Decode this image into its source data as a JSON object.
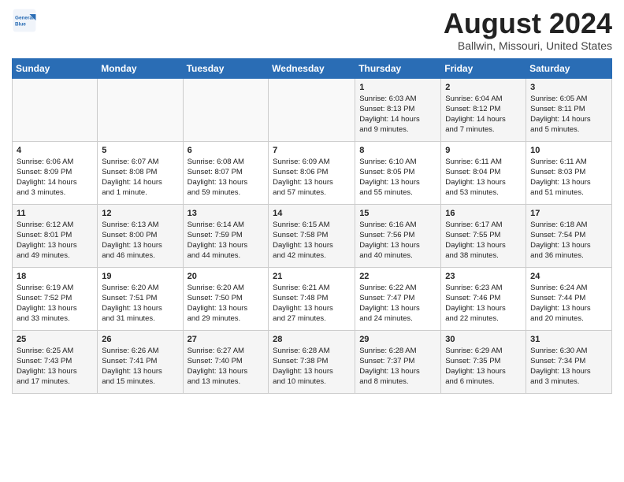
{
  "header": {
    "logo_line1": "General",
    "logo_line2": "Blue",
    "month_title": "August 2024",
    "location": "Ballwin, Missouri, United States"
  },
  "weekdays": [
    "Sunday",
    "Monday",
    "Tuesday",
    "Wednesday",
    "Thursday",
    "Friday",
    "Saturday"
  ],
  "weeks": [
    [
      {
        "day": "",
        "info": ""
      },
      {
        "day": "",
        "info": ""
      },
      {
        "day": "",
        "info": ""
      },
      {
        "day": "",
        "info": ""
      },
      {
        "day": "1",
        "info": "Sunrise: 6:03 AM\nSunset: 8:13 PM\nDaylight: 14 hours\nand 9 minutes."
      },
      {
        "day": "2",
        "info": "Sunrise: 6:04 AM\nSunset: 8:12 PM\nDaylight: 14 hours\nand 7 minutes."
      },
      {
        "day": "3",
        "info": "Sunrise: 6:05 AM\nSunset: 8:11 PM\nDaylight: 14 hours\nand 5 minutes."
      }
    ],
    [
      {
        "day": "4",
        "info": "Sunrise: 6:06 AM\nSunset: 8:09 PM\nDaylight: 14 hours\nand 3 minutes."
      },
      {
        "day": "5",
        "info": "Sunrise: 6:07 AM\nSunset: 8:08 PM\nDaylight: 14 hours\nand 1 minute."
      },
      {
        "day": "6",
        "info": "Sunrise: 6:08 AM\nSunset: 8:07 PM\nDaylight: 13 hours\nand 59 minutes."
      },
      {
        "day": "7",
        "info": "Sunrise: 6:09 AM\nSunset: 8:06 PM\nDaylight: 13 hours\nand 57 minutes."
      },
      {
        "day": "8",
        "info": "Sunrise: 6:10 AM\nSunset: 8:05 PM\nDaylight: 13 hours\nand 55 minutes."
      },
      {
        "day": "9",
        "info": "Sunrise: 6:11 AM\nSunset: 8:04 PM\nDaylight: 13 hours\nand 53 minutes."
      },
      {
        "day": "10",
        "info": "Sunrise: 6:11 AM\nSunset: 8:03 PM\nDaylight: 13 hours\nand 51 minutes."
      }
    ],
    [
      {
        "day": "11",
        "info": "Sunrise: 6:12 AM\nSunset: 8:01 PM\nDaylight: 13 hours\nand 49 minutes."
      },
      {
        "day": "12",
        "info": "Sunrise: 6:13 AM\nSunset: 8:00 PM\nDaylight: 13 hours\nand 46 minutes."
      },
      {
        "day": "13",
        "info": "Sunrise: 6:14 AM\nSunset: 7:59 PM\nDaylight: 13 hours\nand 44 minutes."
      },
      {
        "day": "14",
        "info": "Sunrise: 6:15 AM\nSunset: 7:58 PM\nDaylight: 13 hours\nand 42 minutes."
      },
      {
        "day": "15",
        "info": "Sunrise: 6:16 AM\nSunset: 7:56 PM\nDaylight: 13 hours\nand 40 minutes."
      },
      {
        "day": "16",
        "info": "Sunrise: 6:17 AM\nSunset: 7:55 PM\nDaylight: 13 hours\nand 38 minutes."
      },
      {
        "day": "17",
        "info": "Sunrise: 6:18 AM\nSunset: 7:54 PM\nDaylight: 13 hours\nand 36 minutes."
      }
    ],
    [
      {
        "day": "18",
        "info": "Sunrise: 6:19 AM\nSunset: 7:52 PM\nDaylight: 13 hours\nand 33 minutes."
      },
      {
        "day": "19",
        "info": "Sunrise: 6:20 AM\nSunset: 7:51 PM\nDaylight: 13 hours\nand 31 minutes."
      },
      {
        "day": "20",
        "info": "Sunrise: 6:20 AM\nSunset: 7:50 PM\nDaylight: 13 hours\nand 29 minutes."
      },
      {
        "day": "21",
        "info": "Sunrise: 6:21 AM\nSunset: 7:48 PM\nDaylight: 13 hours\nand 27 minutes."
      },
      {
        "day": "22",
        "info": "Sunrise: 6:22 AM\nSunset: 7:47 PM\nDaylight: 13 hours\nand 24 minutes."
      },
      {
        "day": "23",
        "info": "Sunrise: 6:23 AM\nSunset: 7:46 PM\nDaylight: 13 hours\nand 22 minutes."
      },
      {
        "day": "24",
        "info": "Sunrise: 6:24 AM\nSunset: 7:44 PM\nDaylight: 13 hours\nand 20 minutes."
      }
    ],
    [
      {
        "day": "25",
        "info": "Sunrise: 6:25 AM\nSunset: 7:43 PM\nDaylight: 13 hours\nand 17 minutes."
      },
      {
        "day": "26",
        "info": "Sunrise: 6:26 AM\nSunset: 7:41 PM\nDaylight: 13 hours\nand 15 minutes."
      },
      {
        "day": "27",
        "info": "Sunrise: 6:27 AM\nSunset: 7:40 PM\nDaylight: 13 hours\nand 13 minutes."
      },
      {
        "day": "28",
        "info": "Sunrise: 6:28 AM\nSunset: 7:38 PM\nDaylight: 13 hours\nand 10 minutes."
      },
      {
        "day": "29",
        "info": "Sunrise: 6:28 AM\nSunset: 7:37 PM\nDaylight: 13 hours\nand 8 minutes."
      },
      {
        "day": "30",
        "info": "Sunrise: 6:29 AM\nSunset: 7:35 PM\nDaylight: 13 hours\nand 6 minutes."
      },
      {
        "day": "31",
        "info": "Sunrise: 6:30 AM\nSunset: 7:34 PM\nDaylight: 13 hours\nand 3 minutes."
      }
    ]
  ]
}
